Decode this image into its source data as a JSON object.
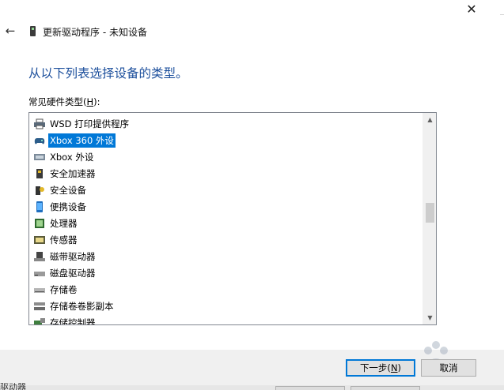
{
  "window": {
    "title": "更新驱动程序 - 未知设备",
    "close_glyph": "✕",
    "back_glyph": "←"
  },
  "main": {
    "heading": "从以下列表选择设备的类型。",
    "list_label_prefix": "常见硬件类型(",
    "list_label_key": "H",
    "list_label_suffix": "):",
    "items": [
      {
        "label": "WSD 打印提供程序",
        "icon": "printer-icon",
        "selected": false
      },
      {
        "label": "Xbox 360 外设",
        "icon": "gamepad-icon",
        "selected": true
      },
      {
        "label": "Xbox 外设",
        "icon": "xbox-peripheral-icon",
        "selected": false
      },
      {
        "label": "安全加速器",
        "icon": "security-accelerator-icon",
        "selected": false
      },
      {
        "label": "安全设备",
        "icon": "security-device-icon",
        "selected": false
      },
      {
        "label": "便携设备",
        "icon": "portable-device-icon",
        "selected": false
      },
      {
        "label": "处理器",
        "icon": "processor-icon",
        "selected": false
      },
      {
        "label": "传感器",
        "icon": "sensor-icon",
        "selected": false
      },
      {
        "label": "磁带驱动器",
        "icon": "tape-drive-icon",
        "selected": false
      },
      {
        "label": "磁盘驱动器",
        "icon": "disk-drive-icon",
        "selected": false
      },
      {
        "label": "存储卷",
        "icon": "storage-volume-icon",
        "selected": false
      },
      {
        "label": "存储卷卷影副本",
        "icon": "shadow-copy-icon",
        "selected": false
      },
      {
        "label": "存储控制器",
        "icon": "storage-controller-icon",
        "selected": false
      }
    ]
  },
  "footer": {
    "next_prefix": "下一步(",
    "next_key": "N",
    "next_suffix": ")",
    "cancel_label": "取消"
  },
  "background": {
    "partial_text": "驱动器"
  },
  "colors": {
    "heading": "#1c4f9c",
    "selection": "#0078d7",
    "footer_bg": "#f0f0f0"
  }
}
